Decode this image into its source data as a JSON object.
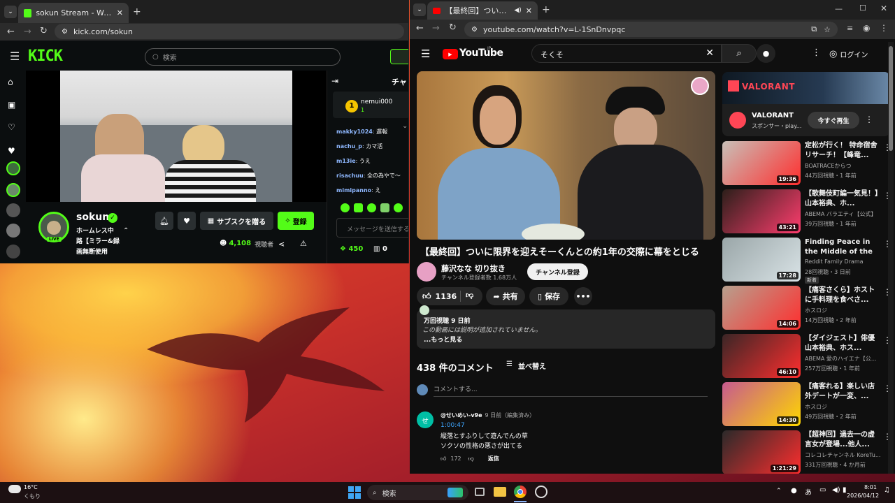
{
  "kick": {
    "tab_title": "sokun Stream - Watch Live on K",
    "url": "kick.com/sokun",
    "logo": "KICK",
    "search_placeholder": "検索",
    "chat_header": "チャ",
    "pinned_user": "nemui000",
    "pinned_count": "1",
    "messages": [
      {
        "user": "makky1024",
        "text": "遅報"
      },
      {
        "user": "nachu_p",
        "text": "カマ活"
      },
      {
        "user": "m13ie",
        "text": "うえ"
      },
      {
        "user": "risachuu",
        "text": "全の為やで〜"
      },
      {
        "user": "mimipanno",
        "text": "え"
      }
    ],
    "chat_input_placeholder": "メッセージを送信する",
    "streamer_name": "sokun",
    "stream_title": "ホームレス中 路【ミラー&録画無断使用",
    "live_badge": "LIVE",
    "gift_sub_label": "サブスクを贈る",
    "follow_label": "登録",
    "viewer_count": "4,108",
    "viewer_label": "視聴者",
    "kicks_count": "450",
    "other_count": "0"
  },
  "youtube": {
    "tab_title": "【最終回】ついに限界を迎えそ",
    "url": "youtube.com/watch?v=L-1SnDnvpqc",
    "logo": "YouTube",
    "logo_suffix": "JP",
    "search_value": "そくそ",
    "login_label": "ログイン",
    "video_title": "【最終回】ついに限界を迎えそーくんとの約1年の交際に幕をとじる",
    "channel_name": "藤沢なな 切り抜き",
    "subscribers": "チャンネル登録者数 1.68万人",
    "subscribe_label": "チャンネル登録",
    "like_count": "1136",
    "share_label": "共有",
    "save_label": "保存",
    "desc_meta": "万回視聴  9 日前",
    "desc_text": "この動画には説明が追加されていません。",
    "desc_more": "...もっと見る",
    "comment_count": "438 件のコメント",
    "sort_label": "並べ替え",
    "comment_placeholder": "コメントする...",
    "comment": {
      "avatar_letter": "せ",
      "author": "@せいめい-v9e",
      "meta": "9 日前（編集済み）",
      "timestamp": "1:00:47",
      "line1": "縦落とすふりして遊んでんの草",
      "line2": "ソクソの性格の悪さが出てる",
      "likes": "172",
      "reply": "返信"
    },
    "ad": {
      "brand": "VALORANT",
      "banner": "VALORANT",
      "sponsor": "スポンサー・play...",
      "cta": "今すぐ再生"
    },
    "recommendations": [
      {
        "title": "定松が行く！ 特命宿舎リサーチ！【峰竜...",
        "channel": "BOATRACEからつ",
        "meta": "44万回視聴・1 年前",
        "duration": "19:36",
        "badge": ""
      },
      {
        "title": "【歌舞伎町編一気見！】山本裕典、ホ...",
        "channel": "ABEMA バラエティ【公式】",
        "meta": "39万回視聴・1 年前",
        "duration": "43:21",
        "badge": ""
      },
      {
        "title": "Finding Peace in the Middle of the City ...",
        "channel": "Reddit Family Drama",
        "meta": "28回視聴・3 日前",
        "duration": "17:28",
        "badge": "新着"
      },
      {
        "title": "【痛客さくら】ホストに手料理を食べさ...",
        "channel": "ホスロジ",
        "meta": "14万回視聴・2 年前",
        "duration": "14:06",
        "badge": ""
      },
      {
        "title": "【ダイジェスト】俳優 山本裕典、ホス...",
        "channel": "ABEMA 愛のハイエナ【公式...",
        "meta": "257万回視聴・1 年前",
        "duration": "46:10",
        "badge": ""
      },
      {
        "title": "【痛客れる】楽しい店外デートが一変、...",
        "channel": "ホスロジ",
        "meta": "49万回視聴・2 年前",
        "duration": "14:30",
        "badge": ""
      },
      {
        "title": "【超神回】過去一の虚言女が登場...他人...",
        "channel": "コレコレチャンネル KoreTu...",
        "meta": "331万回視聴・4 か月前",
        "duration": "1:21:29",
        "badge": ""
      }
    ]
  },
  "taskbar": {
    "temperature": "16°C",
    "weather": "くもり",
    "search_label": "検索",
    "ime": "あ",
    "time": "8:01",
    "date": "2026/04/12"
  }
}
